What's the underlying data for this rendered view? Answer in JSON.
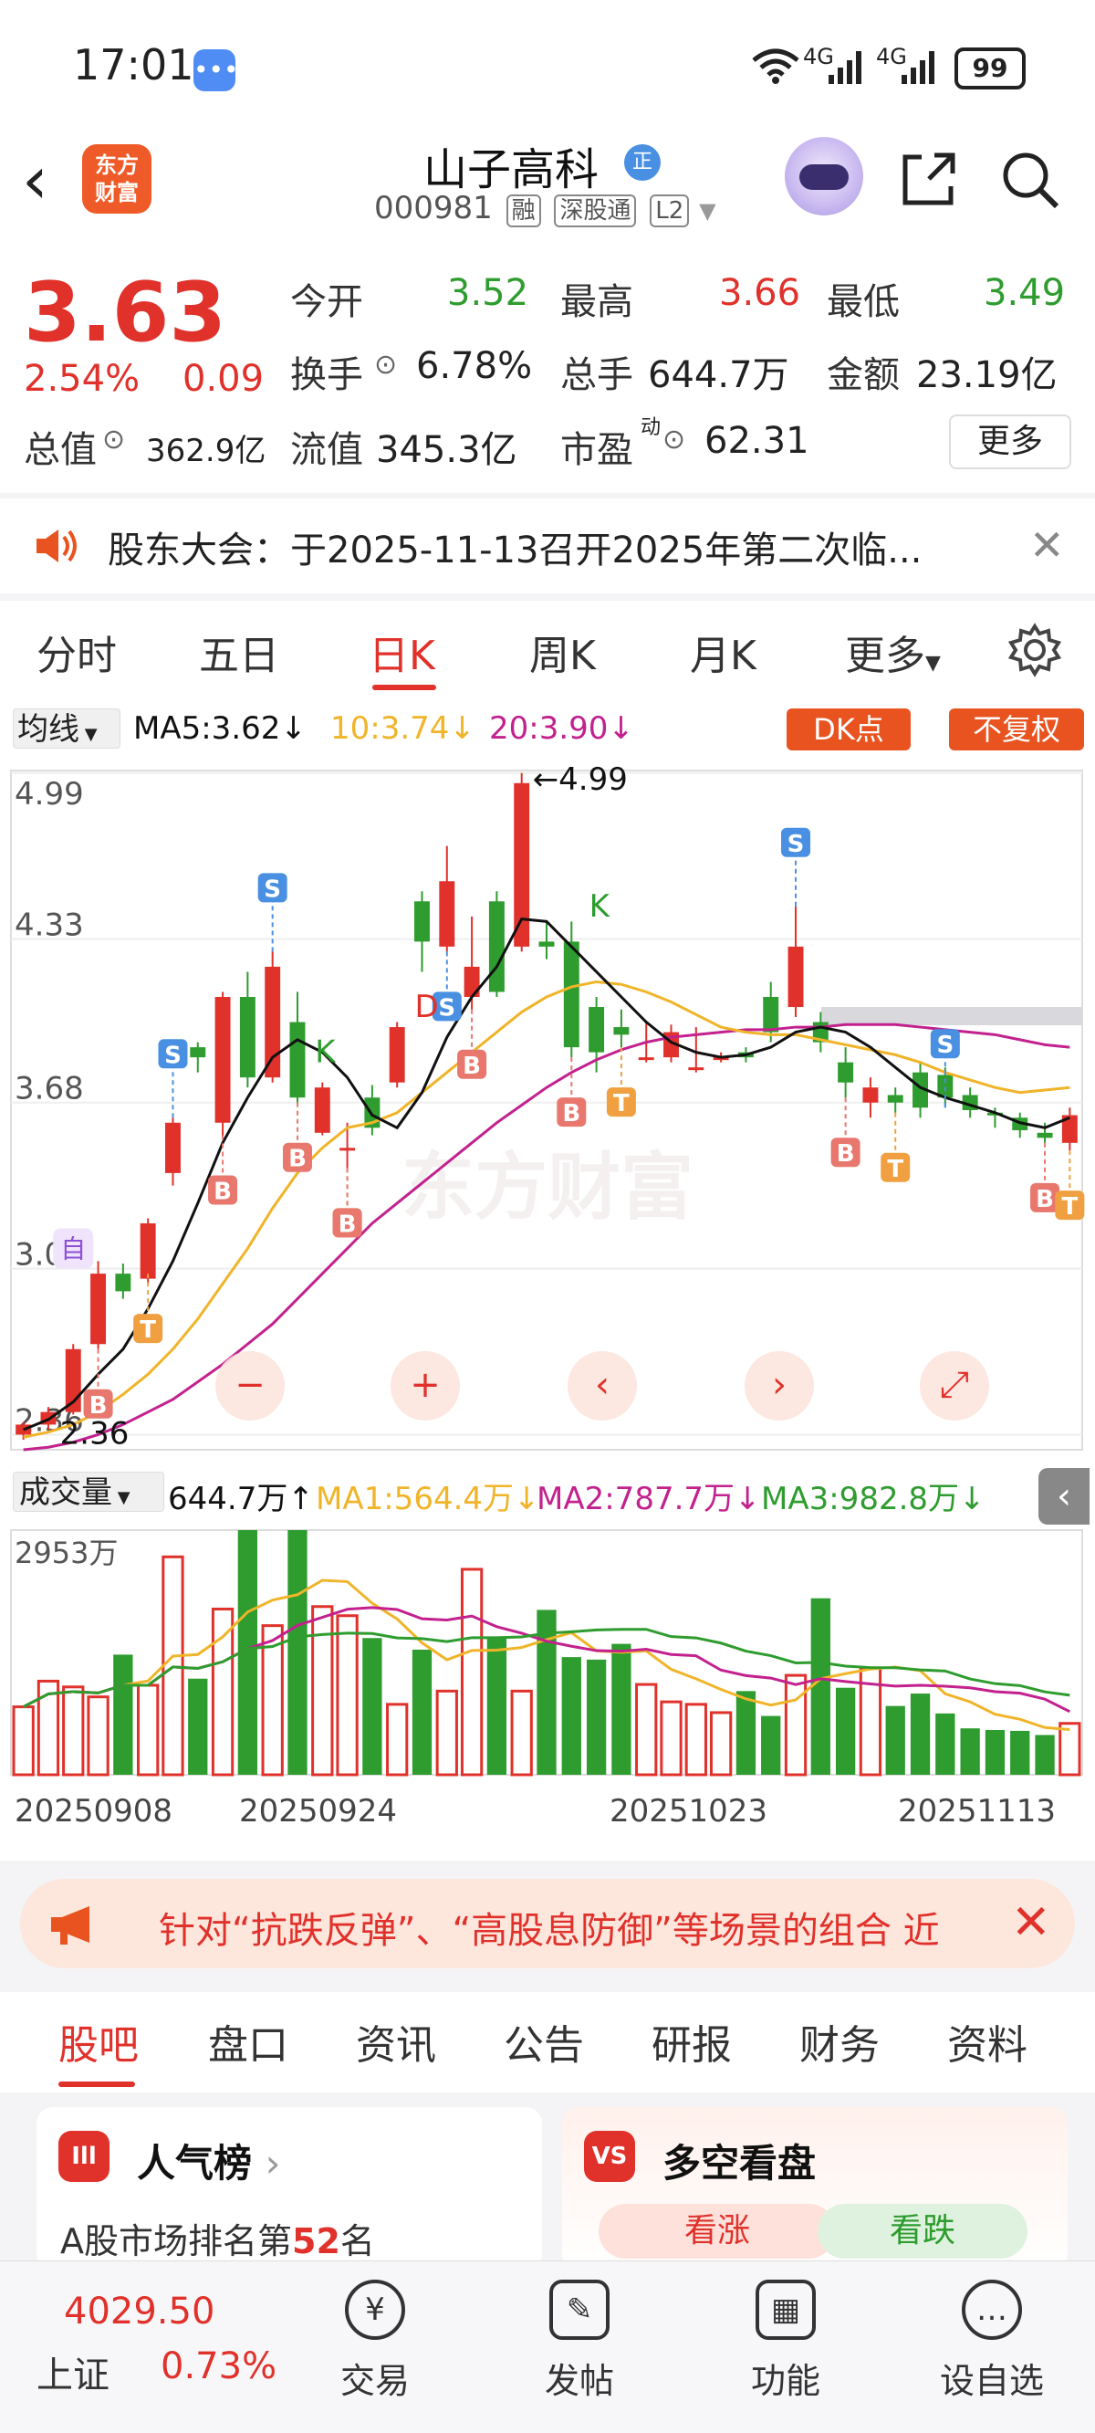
{
  "status": {
    "time": "17:01",
    "net1": "4G",
    "net2": "4G",
    "battery": "99"
  },
  "header": {
    "logo_line1": "东方",
    "logo_line2": "财富",
    "stock_name": "山子高科",
    "badge": "正",
    "code": "000981",
    "tags": [
      "融",
      "深股通",
      "L2"
    ]
  },
  "quote": {
    "price": "3.63",
    "pct": "2.54%",
    "change": "0.09",
    "open_label": "今开",
    "open": "3.52",
    "high_label": "最高",
    "high": "3.66",
    "low_label": "最低",
    "low": "3.49",
    "turnover_label": "换手",
    "turnover": "6.78%",
    "volume_label": "总手",
    "volume": "644.7万",
    "amount_label": "金额",
    "amount": "23.19亿",
    "mcap_label": "总值",
    "mcap": "362.9亿",
    "float_label": "流值",
    "float": "345.3亿",
    "pe_label": "市盈",
    "pe_sup": "动",
    "pe": "62.31",
    "more": "更多"
  },
  "notice": {
    "text": "股东大会：于2025-11-13召开2025年第二次临..."
  },
  "tabs": [
    "分时",
    "五日",
    "日K",
    "周K",
    "月K",
    "更多"
  ],
  "active_tab": "日K",
  "chart_header": {
    "ma_select": "均线",
    "ma5": "MA5:3.62↓",
    "ma10": "10:3.74↓",
    "ma20": "20:3.90↓",
    "dk": "DK点",
    "fq": "不复权"
  },
  "vol_header": {
    "select": "成交量",
    "vol": "644.7万↑",
    "ma1": "MA1:564.4万↓",
    "ma2": "MA2:787.7万↓",
    "ma3": "MA3:982.8万↓"
  },
  "chart_data": {
    "type": "candlestick",
    "y_ticks": [
      "4.99",
      "4.33",
      "3.68",
      "3.02",
      "2.36"
    ],
    "ylim": [
      2.3,
      5.0
    ],
    "max_label": "←4.99",
    "min_label": "2.36",
    "candles": [
      [
        2.36,
        2.4,
        2.34,
        2.41
      ],
      [
        2.4,
        2.45,
        2.38,
        2.47
      ],
      [
        2.45,
        2.7,
        2.44,
        2.72
      ],
      [
        2.72,
        3.0,
        2.7,
        3.05
      ],
      [
        3.0,
        2.93,
        2.9,
        3.04
      ],
      [
        2.98,
        3.2,
        2.96,
        3.22
      ],
      [
        3.4,
        3.6,
        3.35,
        3.62
      ],
      [
        3.9,
        3.86,
        3.8,
        3.92
      ],
      [
        3.6,
        4.1,
        3.55,
        4.12
      ],
      [
        4.1,
        3.78,
        3.74,
        4.2
      ],
      [
        3.78,
        4.22,
        3.76,
        4.28
      ],
      [
        4.0,
        3.7,
        3.68,
        4.12
      ],
      [
        3.56,
        3.74,
        3.55,
        3.76
      ],
      [
        3.5,
        3.5,
        3.42,
        3.6
      ],
      [
        3.7,
        3.58,
        3.55,
        3.75
      ],
      [
        3.76,
        3.98,
        3.74,
        4.0
      ],
      [
        4.48,
        4.32,
        4.2,
        4.52
      ],
      [
        4.3,
        4.56,
        4.28,
        4.7
      ],
      [
        4.1,
        4.22,
        4.05,
        4.42
      ],
      [
        4.48,
        4.12,
        4.1,
        4.52
      ],
      [
        4.3,
        4.95,
        4.28,
        4.99
      ],
      [
        4.32,
        4.3,
        4.25,
        4.4
      ],
      [
        4.32,
        3.9,
        3.86,
        4.4
      ],
      [
        4.06,
        3.88,
        3.8,
        4.1
      ],
      [
        3.98,
        3.95,
        3.9,
        4.05
      ],
      [
        3.86,
        3.86,
        3.84,
        4.0
      ],
      [
        3.86,
        3.96,
        3.84,
        3.99
      ],
      [
        3.82,
        3.82,
        3.8,
        3.98
      ],
      [
        3.86,
        3.86,
        3.84,
        3.88
      ],
      [
        3.88,
        3.86,
        3.84,
        3.9
      ],
      [
        4.1,
        3.96,
        3.92,
        4.16
      ],
      [
        4.06,
        4.3,
        4.02,
        4.46
      ],
      [
        4.0,
        3.92,
        3.88,
        4.04
      ],
      [
        3.84,
        3.76,
        3.7,
        3.9
      ],
      [
        3.68,
        3.74,
        3.62,
        3.78
      ],
      [
        3.71,
        3.68,
        3.64,
        3.74
      ],
      [
        3.8,
        3.66,
        3.62,
        3.84
      ],
      [
        3.79,
        3.7,
        3.66,
        3.82
      ],
      [
        3.71,
        3.65,
        3.62,
        3.74
      ],
      [
        3.64,
        3.63,
        3.58,
        3.66
      ],
      [
        3.62,
        3.57,
        3.54,
        3.64
      ],
      [
        3.56,
        3.54,
        3.52,
        3.6
      ],
      [
        3.52,
        3.63,
        3.49,
        3.66
      ]
    ],
    "ma5": [
      2.38,
      2.42,
      2.49,
      2.6,
      2.7,
      2.86,
      3.05,
      3.28,
      3.52,
      3.7,
      3.86,
      3.93,
      3.88,
      3.78,
      3.63,
      3.58,
      3.72,
      3.94,
      4.1,
      4.22,
      4.41,
      4.4,
      4.3,
      4.2,
      4.1,
      4.0,
      3.92,
      3.88,
      3.86,
      3.87,
      3.9,
      3.96,
      3.98,
      3.96,
      3.9,
      3.82,
      3.74,
      3.7,
      3.67,
      3.64,
      3.6,
      3.58,
      3.62
    ],
    "ma10": [
      2.35,
      2.37,
      2.4,
      2.45,
      2.52,
      2.6,
      2.7,
      2.82,
      2.96,
      3.1,
      3.26,
      3.4,
      3.5,
      3.58,
      3.6,
      3.64,
      3.72,
      3.8,
      3.88,
      3.96,
      4.04,
      4.1,
      4.14,
      4.16,
      4.15,
      4.12,
      4.08,
      4.03,
      3.98,
      3.96,
      3.95,
      3.95,
      3.93,
      3.91,
      3.89,
      3.87,
      3.84,
      3.8,
      3.77,
      3.74,
      3.72,
      3.73,
      3.74
    ],
    "ma20": [
      2.3,
      2.31,
      2.33,
      2.36,
      2.4,
      2.45,
      2.5,
      2.57,
      2.64,
      2.72,
      2.8,
      2.9,
      3.0,
      3.1,
      3.2,
      3.28,
      3.36,
      3.44,
      3.52,
      3.6,
      3.67,
      3.74,
      3.8,
      3.85,
      3.89,
      3.92,
      3.94,
      3.95,
      3.96,
      3.97,
      3.97,
      3.98,
      3.98,
      3.99,
      3.99,
      3.99,
      3.98,
      3.97,
      3.96,
      3.95,
      3.93,
      3.91,
      3.9
    ],
    "volume": {
      "max_label": "2953万",
      "values": [
        820,
        1130,
        1060,
        940,
        1450,
        1080,
        2630,
        1160,
        2000,
        2953,
        1800,
        2953,
        2030,
        1920,
        1650,
        850,
        1510,
        1010,
        2480,
        1670,
        1010,
        1990,
        1420,
        1390,
        1580,
        1090,
        880,
        850,
        750,
        1010,
        710,
        1200,
        2130,
        1050,
        1290,
        830,
        980,
        740,
        560,
        540,
        530,
        480,
        620
      ],
      "ma1": [],
      "x_dates": [
        "20250908",
        "20250924",
        "20251023",
        "20251113"
      ]
    },
    "markers": [
      "自",
      "S",
      "B",
      "T",
      "K",
      "D"
    ]
  },
  "chart_controls": [
    "zoom-out",
    "zoom-in",
    "prev",
    "next",
    "expand"
  ],
  "strategy": {
    "text": "针对“抗跌反弹”、“高股息防御”等场景的组合 近"
  },
  "section_tabs": [
    "股吧",
    "盘口",
    "资讯",
    "公告",
    "研报",
    "财务",
    "资料"
  ],
  "cards": {
    "left_title": "人气榜",
    "left_icon": "Ill",
    "rank_pre": "A股市场排名第",
    "rank_num": "52",
    "rank_post": "名",
    "right_title": "多空看盘",
    "right_icon": "VS",
    "bull": "看涨",
    "bear": "看跌"
  },
  "bottom_nav": {
    "index_value": "4029.50",
    "index_name": "上证",
    "index_pct": "0.73%",
    "items": [
      {
        "label": "交易",
        "icon": "¥"
      },
      {
        "label": "发帖",
        "icon": "✎"
      },
      {
        "label": "功能",
        "icon": "▦"
      },
      {
        "label": "设自选",
        "icon": "…"
      }
    ]
  },
  "colors": {
    "up": "#e0312b",
    "down": "#2e9c2e",
    "ma5": "#111111",
    "ma10": "#f0b429",
    "ma20": "#c2218e"
  }
}
